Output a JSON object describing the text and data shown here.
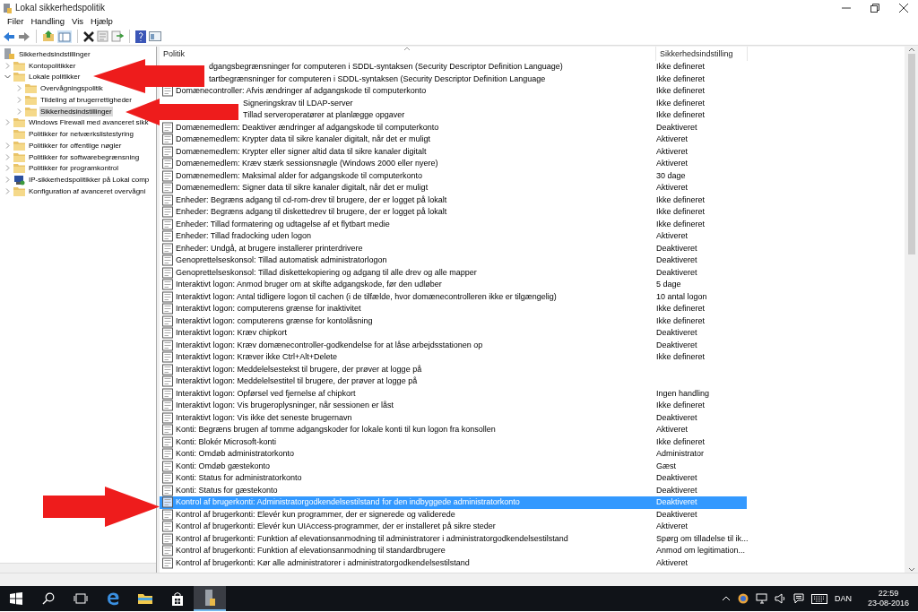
{
  "window": {
    "title": "Lokal sikkerhedspolitik"
  },
  "menu": [
    "Filer",
    "Handling",
    "Vis",
    "Hjælp"
  ],
  "tree": {
    "label": "Sikkerhedsindstillinger",
    "selected": false,
    "children": [
      {
        "label": "Kontopolitikker",
        "kind": "folder",
        "expanded": false,
        "selected": false
      },
      {
        "label": "Lokale politikker",
        "kind": "folder",
        "expanded": true,
        "selected": false,
        "children": [
          {
            "label": "Overvågningspolitik",
            "kind": "folder",
            "expanded": false,
            "selected": false
          },
          {
            "label": "Tildeling af brugerrettigheder",
            "kind": "folder",
            "expanded": false,
            "selected": false
          },
          {
            "label": "Sikkerhedsindstillinger",
            "kind": "folder",
            "expanded": false,
            "selected": true
          }
        ]
      },
      {
        "label": "Windows Firewall med avanceret sikk",
        "kind": "folder",
        "expanded": false,
        "selected": false
      },
      {
        "label": "Politikker for netværkslistestyring",
        "kind": "folder",
        "selected": false
      },
      {
        "label": "Politikker for offentlige nøgler",
        "kind": "folder",
        "expanded": false,
        "selected": false
      },
      {
        "label": "Politikker for softwarebegrænsning",
        "kind": "folder",
        "expanded": false,
        "selected": false
      },
      {
        "label": "Politikker for programkontrol",
        "kind": "folder",
        "expanded": false,
        "selected": false
      },
      {
        "label": "IP-sikkerhedspolitikker på Lokal comp",
        "kind": "network-policy",
        "expanded": false,
        "selected": false
      },
      {
        "label": "Konfiguration af avanceret overvågni",
        "kind": "folder",
        "expanded": false,
        "selected": false
      }
    ]
  },
  "table": {
    "columns": [
      "Politik",
      "Sikkerhedsindstilling"
    ],
    "rows": [
      {
        "policy": "dgangsbegrænsninger for computeren i SDDL-syntaksen (Security Descriptor Definition Language)",
        "setting": "Ikke defineret",
        "selected": false,
        "under_arrow": true
      },
      {
        "policy": "tartbegrænsninger for computeren i SDDL-syntaksen (Security Descriptor Definition Language",
        "setting": "Ikke defineret",
        "selected": false,
        "under_arrow": true
      },
      {
        "policy": "Domænecontroller: Afvis ændringer af adgangskode til computerkonto",
        "setting": "Ikke defineret",
        "selected": false,
        "under_arrow": false
      },
      {
        "policy": "Signeringskrav til LDAP-server",
        "setting": "Ikke defineret",
        "selected": false,
        "under_arrow": true
      },
      {
        "policy": "Tillad serveroperatører at planlægge opgaver",
        "setting": "Ikke defineret",
        "selected": false,
        "under_arrow": true
      },
      {
        "policy": "Domænemedlem: Deaktiver ændringer af adgangskode til computerkonto",
        "setting": "Deaktiveret",
        "selected": false,
        "under_arrow": false
      },
      {
        "policy": "Domænemedlem: Krypter data til sikre kanaler digitalt, når det er muligt",
        "setting": "Aktiveret",
        "selected": false,
        "under_arrow": false
      },
      {
        "policy": "Domænemedlem: Krypter eller signer altid data til sikre kanaler digitalt",
        "setting": "Aktiveret",
        "selected": false,
        "under_arrow": false
      },
      {
        "policy": "Domænemedlem: Kræv stærk sessionsnøgle (Windows 2000 eller nyere)",
        "setting": "Aktiveret",
        "selected": false,
        "under_arrow": false
      },
      {
        "policy": "Domænemedlem: Maksimal alder for adgangskode til computerkonto",
        "setting": "30 dage",
        "selected": false,
        "under_arrow": false
      },
      {
        "policy": "Domænemedlem: Signer data til sikre kanaler digitalt, når det er muligt",
        "setting": "Aktiveret",
        "selected": false,
        "under_arrow": false
      },
      {
        "policy": "Enheder: Begræns adgang til cd-rom-drev til brugere, der er logget på lokalt",
        "setting": "Ikke defineret",
        "selected": false,
        "under_arrow": false
      },
      {
        "policy": "Enheder: Begræns adgang til diskettedrev til brugere, der er logget på lokalt",
        "setting": "Ikke defineret",
        "selected": false,
        "under_arrow": false
      },
      {
        "policy": "Enheder: Tillad formatering og udtagelse af et flytbart medie",
        "setting": "Ikke defineret",
        "selected": false,
        "under_arrow": false
      },
      {
        "policy": "Enheder: Tillad fradocking uden logon",
        "setting": "Aktiveret",
        "selected": false,
        "under_arrow": false
      },
      {
        "policy": "Enheder: Undgå, at brugere installerer printerdrivere",
        "setting": "Deaktiveret",
        "selected": false,
        "under_arrow": false
      },
      {
        "policy": "Genoprettelseskonsol: Tillad automatisk administratorlogon",
        "setting": "Deaktiveret",
        "selected": false,
        "under_arrow": false
      },
      {
        "policy": "Genoprettelseskonsol: Tillad diskettekopiering og adgang til alle drev og alle mapper",
        "setting": "Deaktiveret",
        "selected": false,
        "under_arrow": false
      },
      {
        "policy": "Interaktivt logon: Anmod bruger om at skifte adgangskode, før den udløber",
        "setting": "5 dage",
        "selected": false,
        "under_arrow": false
      },
      {
        "policy": "Interaktivt logon: Antal tidligere logon til cachen (i de tilfælde, hvor domænecontrolleren ikke er tilgængelig)",
        "setting": "10 antal logon",
        "selected": false,
        "under_arrow": false
      },
      {
        "policy": "Interaktivt logon: computerens grænse for inaktivitet",
        "setting": "Ikke defineret",
        "selected": false,
        "under_arrow": false
      },
      {
        "policy": "Interaktivt logon: computerens grænse for kontolåsning",
        "setting": "Ikke defineret",
        "selected": false,
        "under_arrow": false
      },
      {
        "policy": "Interaktivt logon: Kræv chipkort",
        "setting": "Deaktiveret",
        "selected": false,
        "under_arrow": false
      },
      {
        "policy": "Interaktivt logon: Kræv domænecontroller-godkendelse for at låse arbejdsstationen op",
        "setting": "Deaktiveret",
        "selected": false,
        "under_arrow": false
      },
      {
        "policy": "Interaktivt logon: Kræver ikke Ctrl+Alt+Delete",
        "setting": "Ikke defineret",
        "selected": false,
        "under_arrow": false
      },
      {
        "policy": "Interaktivt logon: Meddelelsestekst til brugere, der prøver at logge på",
        "selected": false,
        "under_arrow": false
      },
      {
        "policy": "Interaktivt logon: Meddelelsestitel til brugere, der prøver at logge på",
        "selected": false,
        "under_arrow": false
      },
      {
        "policy": "Interaktivt logon: Opførsel ved fjernelse af chipkort",
        "setting": "Ingen handling",
        "selected": false,
        "under_arrow": false
      },
      {
        "policy": "Interaktivt logon: Vis brugeroplysninger, når sessionen er låst",
        "setting": "Ikke defineret",
        "selected": false,
        "under_arrow": false
      },
      {
        "policy": "Interaktivt logon: Vis ikke det seneste brugernavn",
        "setting": "Deaktiveret",
        "selected": false,
        "under_arrow": false
      },
      {
        "policy": "Konti: Begræns brugen af tomme adgangskoder for lokale konti til kun logon fra konsollen",
        "setting": "Aktiveret",
        "selected": false,
        "under_arrow": false
      },
      {
        "policy": "Konti: Blokér Microsoft-konti",
        "setting": "Ikke defineret",
        "selected": false,
        "under_arrow": false
      },
      {
        "policy": "Konti: Omdøb administratorkonto",
        "setting": "Administrator",
        "selected": false,
        "under_arrow": false
      },
      {
        "policy": "Konti: Omdøb gæstekonto",
        "setting": "Gæst",
        "selected": false,
        "under_arrow": false
      },
      {
        "policy": "Konti: Status for administratorkonto",
        "setting": "Deaktiveret",
        "selected": false,
        "under_arrow": false
      },
      {
        "policy": "Konti: Status for gæstekonto",
        "setting": "Deaktiveret",
        "selected": false,
        "under_arrow": false
      },
      {
        "policy": "Kontrol af brugerkonti: Administratorgodkendelsestilstand for den indbyggede administratorkonto",
        "setting": "Deaktiveret",
        "selected": true,
        "under_arrow": false
      },
      {
        "policy": "Kontrol af brugerkonti: Elevér kun programmer, der er signerede og validerede",
        "setting": "Deaktiveret",
        "selected": false,
        "under_arrow": false
      },
      {
        "policy": "Kontrol af brugerkonti: Elevér kun UIAccess-programmer, der er installeret på sikre steder",
        "setting": "Aktiveret",
        "selected": false,
        "under_arrow": false
      },
      {
        "policy": "Kontrol af brugerkonti: Funktion af elevationsanmodning til administratorer i administratorgodkendelsestilstand",
        "setting": "Spørg om tilladelse til ik...",
        "selected": false,
        "under_arrow": false
      },
      {
        "policy": "Kontrol af brugerkonti: Funktion af elevationsanmodning til standardbrugere",
        "setting": "Anmod om legitimation...",
        "selected": false,
        "under_arrow": false
      },
      {
        "policy": "Kontrol af brugerkonti: Kør alle administratorer i administratorgodkendelsestilstand",
        "setting": "Aktiveret",
        "selected": false,
        "under_arrow": false
      }
    ]
  },
  "annotations": [
    {
      "kind": "left-arrow"
    },
    {
      "kind": "left-arrow"
    },
    {
      "kind": "right-arrow"
    }
  ],
  "taskbar": {
    "language": "DAN",
    "time": "22:59",
    "date": "23-08-2016"
  }
}
